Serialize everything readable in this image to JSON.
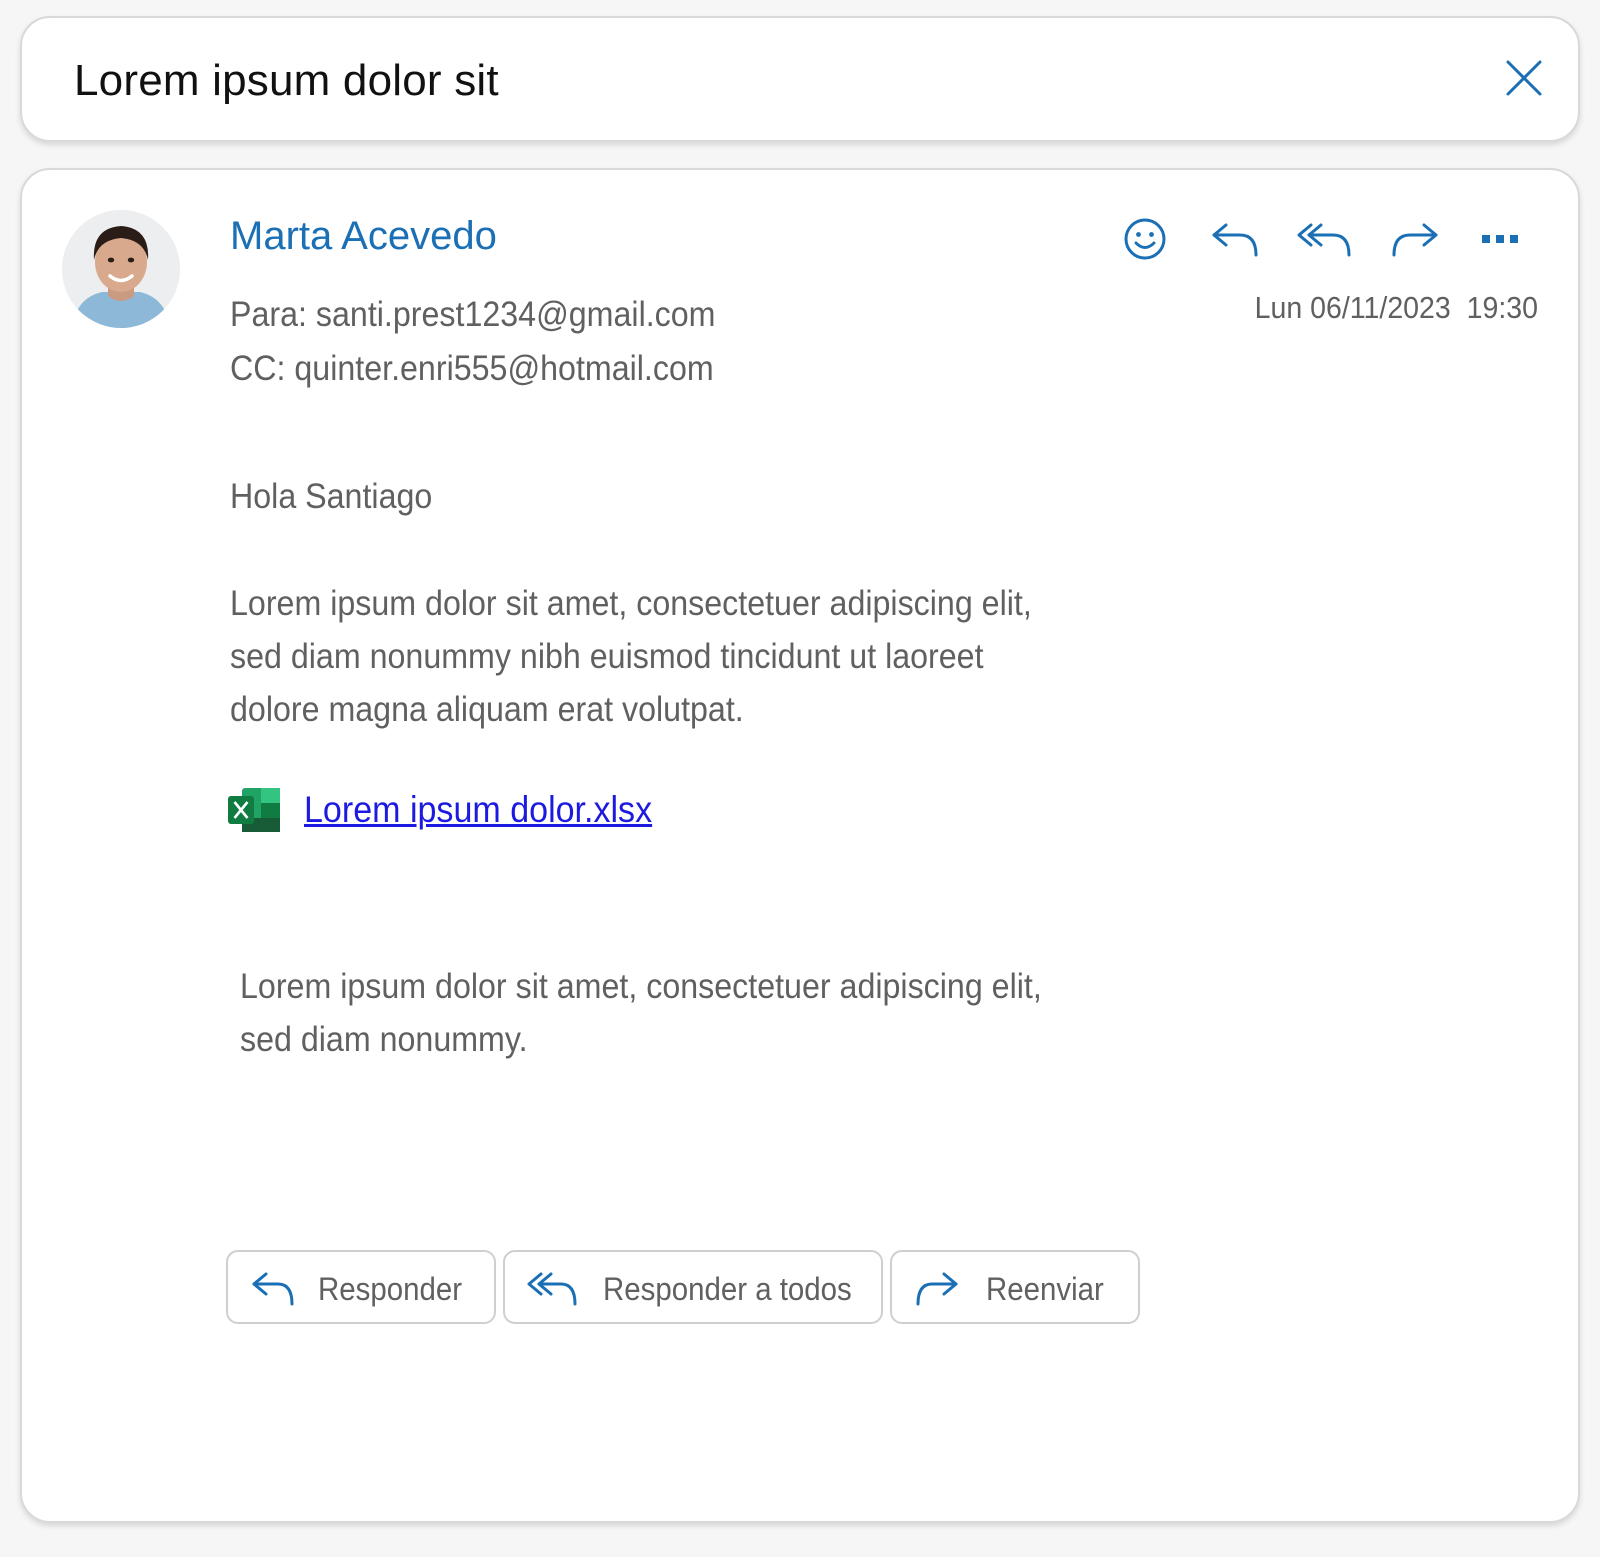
{
  "subject": {
    "text": "Lorem ipsum dolor sit"
  },
  "header": {
    "sender": "Marta Acevedo",
    "to": "Para: santi.prest1234@gmail.com",
    "cc": "CC: quinter.enri555@hotmail.com",
    "date": "Lun 06/11/2023  19:30"
  },
  "toolbar_icons": [
    "smiley-icon",
    "reply-icon",
    "reply-all-icon",
    "forward-icon",
    "more-icon"
  ],
  "body": {
    "greeting": "Hola Santiago",
    "paragraph": "Lorem ipsum dolor sit amet, consectetuer adipiscing elit, sed diam nonummy nibh euismod tincidunt ut laoreet dolore magna aliquam erat volutpat.",
    "paragraph_lines": [
      "Lorem ipsum dolor sit amet, consectetuer adipiscing elit,",
      "sed diam nonummy nibh euismod tincidunt ut laoreet",
      "dolore magna aliquam erat volutpat."
    ],
    "signature_lines": [
      "Lorem ipsum dolor sit amet, consectetuer adipiscing elit,",
      "sed diam nonummy."
    ]
  },
  "attachment": {
    "name": "Lorem ipsum dolor.xlsx",
    "icon": "excel-icon"
  },
  "actions": {
    "reply": "Responder",
    "reply_all": "Responder a todos",
    "forward": "Reenviar"
  },
  "colors": {
    "accent": "#1a6fb5",
    "link": "#1c1ae0",
    "text_secondary": "#606060",
    "excel_green": "#21a366"
  }
}
